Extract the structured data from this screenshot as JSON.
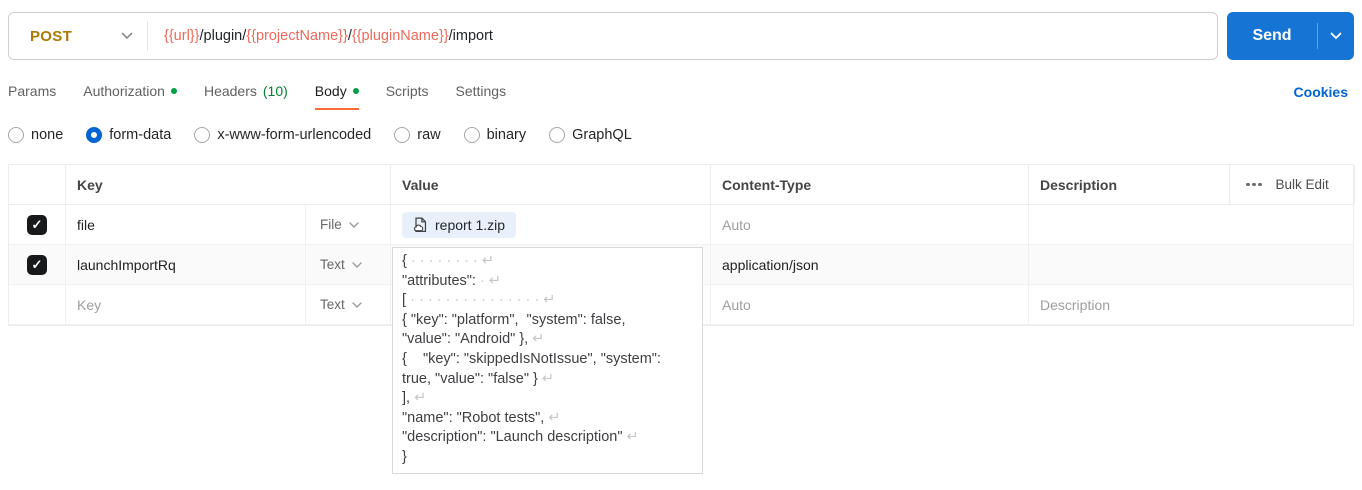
{
  "request": {
    "method": "POST",
    "url_segments": [
      {
        "text": "{{url}}",
        "variable": true
      },
      {
        "text": "/plugin/",
        "variable": false
      },
      {
        "text": "{{projectName}}",
        "variable": true
      },
      {
        "text": "/",
        "variable": false
      },
      {
        "text": "{{pluginName}}",
        "variable": true
      },
      {
        "text": "/import",
        "variable": false
      }
    ],
    "send_label": "Send"
  },
  "tabs": {
    "items": [
      {
        "label": "Params"
      },
      {
        "label": "Authorization",
        "has_dot": true
      },
      {
        "label": "Headers",
        "count": "(10)"
      },
      {
        "label": "Body",
        "has_dot": true,
        "active": true
      },
      {
        "label": "Scripts"
      },
      {
        "label": "Settings"
      }
    ],
    "cookies_link": "Cookies"
  },
  "body_modes": {
    "options": [
      {
        "label": "none"
      },
      {
        "label": "form-data",
        "selected": true
      },
      {
        "label": "x-www-form-urlencoded"
      },
      {
        "label": "raw"
      },
      {
        "label": "binary"
      },
      {
        "label": "GraphQL"
      }
    ]
  },
  "form_table": {
    "headers": {
      "key": "Key",
      "value": "Value",
      "content_type": "Content-Type",
      "description": "Description"
    },
    "bulk_edit_label": "Bulk Edit",
    "rows": [
      {
        "checked": true,
        "key": "file",
        "type": "File",
        "file_name": "report 1.zip",
        "content_type_placeholder": "Auto",
        "description": ""
      },
      {
        "checked": true,
        "key": "launchImportRq",
        "type": "Text",
        "content_type": "application/json",
        "description": ""
      },
      {
        "key_placeholder": "Key",
        "type": "Text",
        "content_type_placeholder": "Auto",
        "description_placeholder": "Description"
      }
    ],
    "value_editor_lines": [
      "{ · · · · · · · · ↵",
      "\"attributes\": · ↵",
      "[ · · · · · · · · · · · · · · · ↵",
      "{ \"key\": \"platform\",  \"system\": false,",
      "\"value\": \"Android\" }, ↵",
      "{    \"key\": \"skippedIsNotIssue\", \"system\":",
      "true, \"value\": \"false\" } ↵",
      "], ↵",
      "\"name\": \"Robot tests\", ↵",
      "\"description\": \"Launch description\" ↵",
      "}"
    ]
  },
  "colors": {
    "method_post": "#AD7A03",
    "variable": "#ED6A5A",
    "send_button": "#1574D4",
    "link_blue": "#0265D2",
    "tab_active_underline": "#FF6C37",
    "status_dot_green": "#00A047",
    "headers_count_green": "#007F31"
  }
}
